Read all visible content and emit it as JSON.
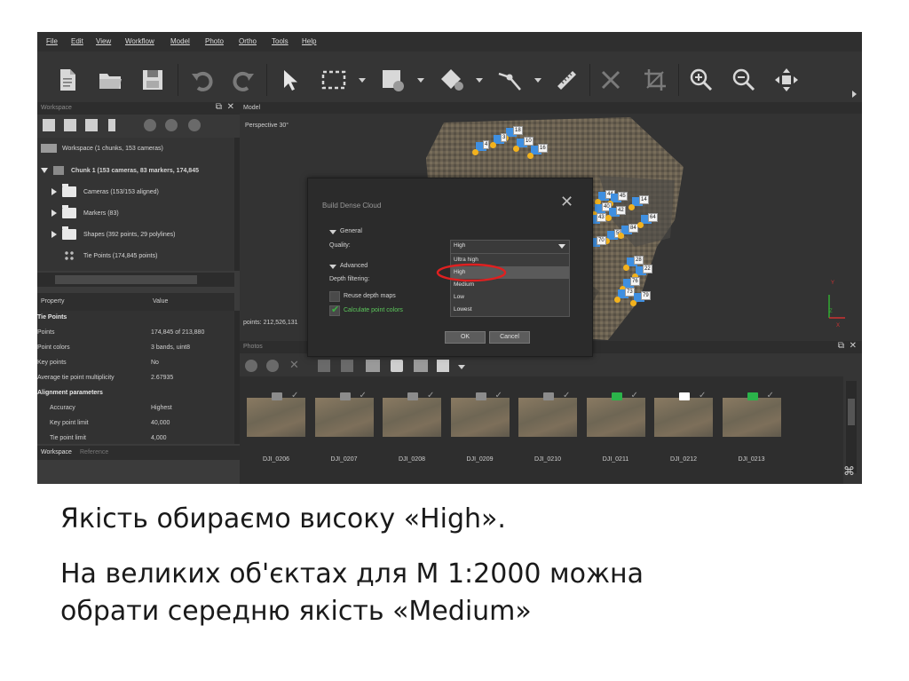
{
  "menu": [
    "File",
    "Edit",
    "View",
    "Workflow",
    "Model",
    "Photo",
    "Ortho",
    "Tools",
    "Help"
  ],
  "workspace": {
    "header": "Workspace",
    "tree": [
      "Workspace (1 chunks, 153 cameras)",
      "Chunk 1 (153 cameras, 83 markers, 174,845",
      "Cameras (153/153 aligned)",
      "Markers (83)",
      "Shapes (392 points, 29 polylines)",
      "Tie Points (174,845 points)"
    ],
    "props_header": {
      "property": "Property",
      "value": "Value"
    },
    "props": [
      {
        "k": "Tie Points",
        "v": "",
        "section": true
      },
      {
        "k": "Points",
        "v": "174,845 of 213,880"
      },
      {
        "k": "Point colors",
        "v": "3 bands, uint8"
      },
      {
        "k": "Key points",
        "v": "No"
      },
      {
        "k": "Average tie point multiplicity",
        "v": "2.67935"
      },
      {
        "k": "Alignment parameters",
        "v": "",
        "section": true
      },
      {
        "k": "Accuracy",
        "v": "Highest"
      },
      {
        "k": "Key point limit",
        "v": "40,000"
      },
      {
        "k": "Tie point limit",
        "v": "4,000"
      }
    ],
    "tabs": [
      "Workspace",
      "Reference"
    ]
  },
  "model": {
    "tab": "Model",
    "view_label": "Perspective 30°",
    "points_label": "points: 212,526,131",
    "markers": [
      "18",
      "10",
      "4",
      "3",
      "44",
      "45",
      "40",
      "43",
      "16",
      "36",
      "42",
      "14",
      "21",
      "48",
      "59",
      "70",
      "84",
      "28",
      "64",
      "22",
      "76",
      "73",
      "79"
    ],
    "axes": {
      "y": "Y",
      "x": "X",
      "z": "Z"
    }
  },
  "dialog": {
    "title": "Build Dense Cloud",
    "general_label": "General",
    "quality_label": "Quality:",
    "quality_value": "High",
    "advanced_label": "Advanced",
    "depth_filtering_label": "Depth filtering:",
    "reuse_label": "Reuse depth maps",
    "calc_label": "Calculate point colors",
    "options": [
      "Ultra high",
      "High",
      "Medium",
      "Low",
      "Lowest"
    ],
    "selected_option": "High",
    "ok": "OK",
    "cancel": "Cancel",
    "highlight_color": "#e02020",
    "check_color": "#3cb043"
  },
  "photos": {
    "header": "Photos",
    "items": [
      "DJI_0206",
      "DJI_0207",
      "DJI_0208",
      "DJI_0209",
      "DJI_0210",
      "DJI_0211",
      "DJI_0212",
      "DJI_0213"
    ]
  },
  "caption": {
    "line1": "Якість обираємо високу «High».",
    "line2": "На великих об'єктах для М 1:2000 можна",
    "line3": "обрати середню якість «Medium»"
  }
}
